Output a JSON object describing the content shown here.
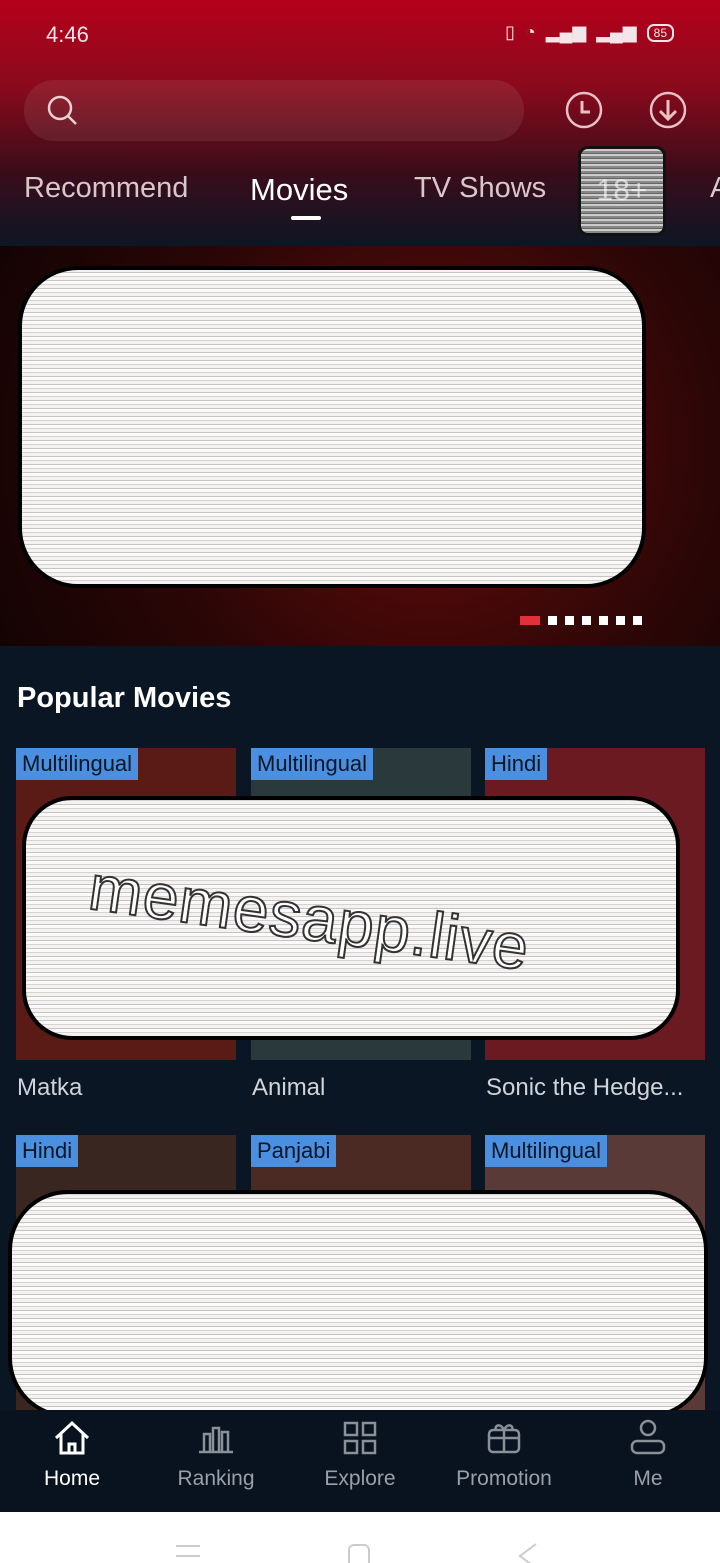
{
  "status": {
    "time": "4:46",
    "battery": "85"
  },
  "header": {
    "tabs": [
      "Recommend",
      "Movies",
      "TV Shows",
      "18+",
      "A"
    ],
    "active_tab": "Movies"
  },
  "banner": {
    "slide_count": 8,
    "active_slide": 1
  },
  "section": {
    "title": "Popular Movies"
  },
  "movies": [
    {
      "badge": "Multilingual",
      "title": "Matka"
    },
    {
      "badge": "Multilingual",
      "title": "Animal"
    },
    {
      "badge": "Hindi",
      "title": "Sonic the Hedge..."
    },
    {
      "badge": "Hindi",
      "title": ""
    },
    {
      "badge": "Panjabi",
      "title": ""
    },
    {
      "badge": "Multilingual",
      "title": ""
    }
  ],
  "watermark": "memesapp.live",
  "nav": {
    "items": [
      "Home",
      "Ranking",
      "Explore",
      "Promotion",
      "Me"
    ],
    "active": "Home"
  },
  "colors": {
    "badge": "#4a8fe0",
    "accent": "#e0303a",
    "header": "#b5001b"
  }
}
